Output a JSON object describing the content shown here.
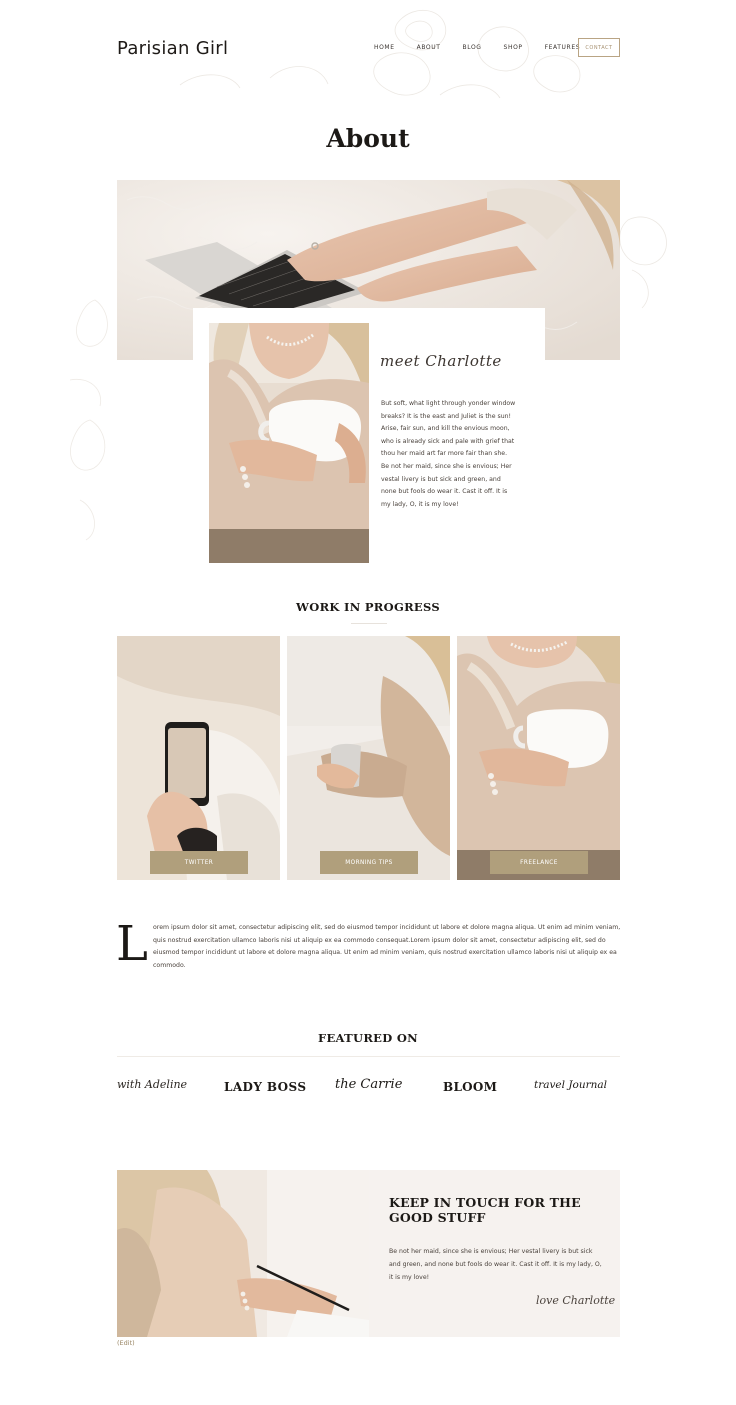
{
  "brand": {
    "name": "Parisian Girl"
  },
  "nav": {
    "items": [
      "HOME",
      "ABOUT",
      "BLOG",
      "SHOP",
      "FEATURES"
    ],
    "contact": "CONTACT"
  },
  "page_title": "About",
  "about": {
    "script_title": "meet Charlotte",
    "body": "But soft, what light through yonder window breaks? It is the east and Juliet is the sun! Arise, fair sun, and kill the envious moon, who is already sick and pale with grief that thou her maid art far more fair than she. Be not her maid, since she is envious; Her vestal livery is but sick and green, and none but fools do wear it. Cast it off. It is my lady, O, it is my love!"
  },
  "work": {
    "heading": "WORK IN PROGRESS",
    "cards": [
      {
        "label": "TWITTER"
      },
      {
        "label": "MORNING TIPS"
      },
      {
        "label": "FREELANCE"
      }
    ]
  },
  "intro": {
    "dropcap": "L",
    "body": "orem ipsum dolor sit amet, consectetur adipiscing elit, sed do eiusmod tempor incididunt ut labore et dolore magna aliqua. Ut enim ad minim veniam, quis nostrud exercitation ullamco laboris nisi ut aliquip ex ea commodo consequat.Lorem ipsum dolor sit amet, consectetur adipiscing elit, sed do eiusmod tempor incididunt ut labore et dolore magna aliqua. Ut enim ad minim veniam, quis nostrud exercitation ullamco laboris nisi ut aliquip ex ea commodo."
  },
  "featured": {
    "heading": "FEATURED ON",
    "logos": [
      "with Adeline",
      "LADY BOSS",
      "the Carrie",
      "BLOOM",
      "travel Journal"
    ]
  },
  "keep_in_touch": {
    "title": "KEEP IN TOUCH FOR THE GOOD STUFF",
    "body": "Be not her maid, since she is envious; Her vestal livery is but sick and green, and none but fools do wear it. Cast it off. It is my lady, O, it is my love!",
    "signature": "love Charlotte"
  },
  "edit_link": "(Edit)",
  "colors": {
    "accent": "#b09f7c",
    "contact_border": "#b9a484",
    "panel": "#f6f2ef"
  }
}
